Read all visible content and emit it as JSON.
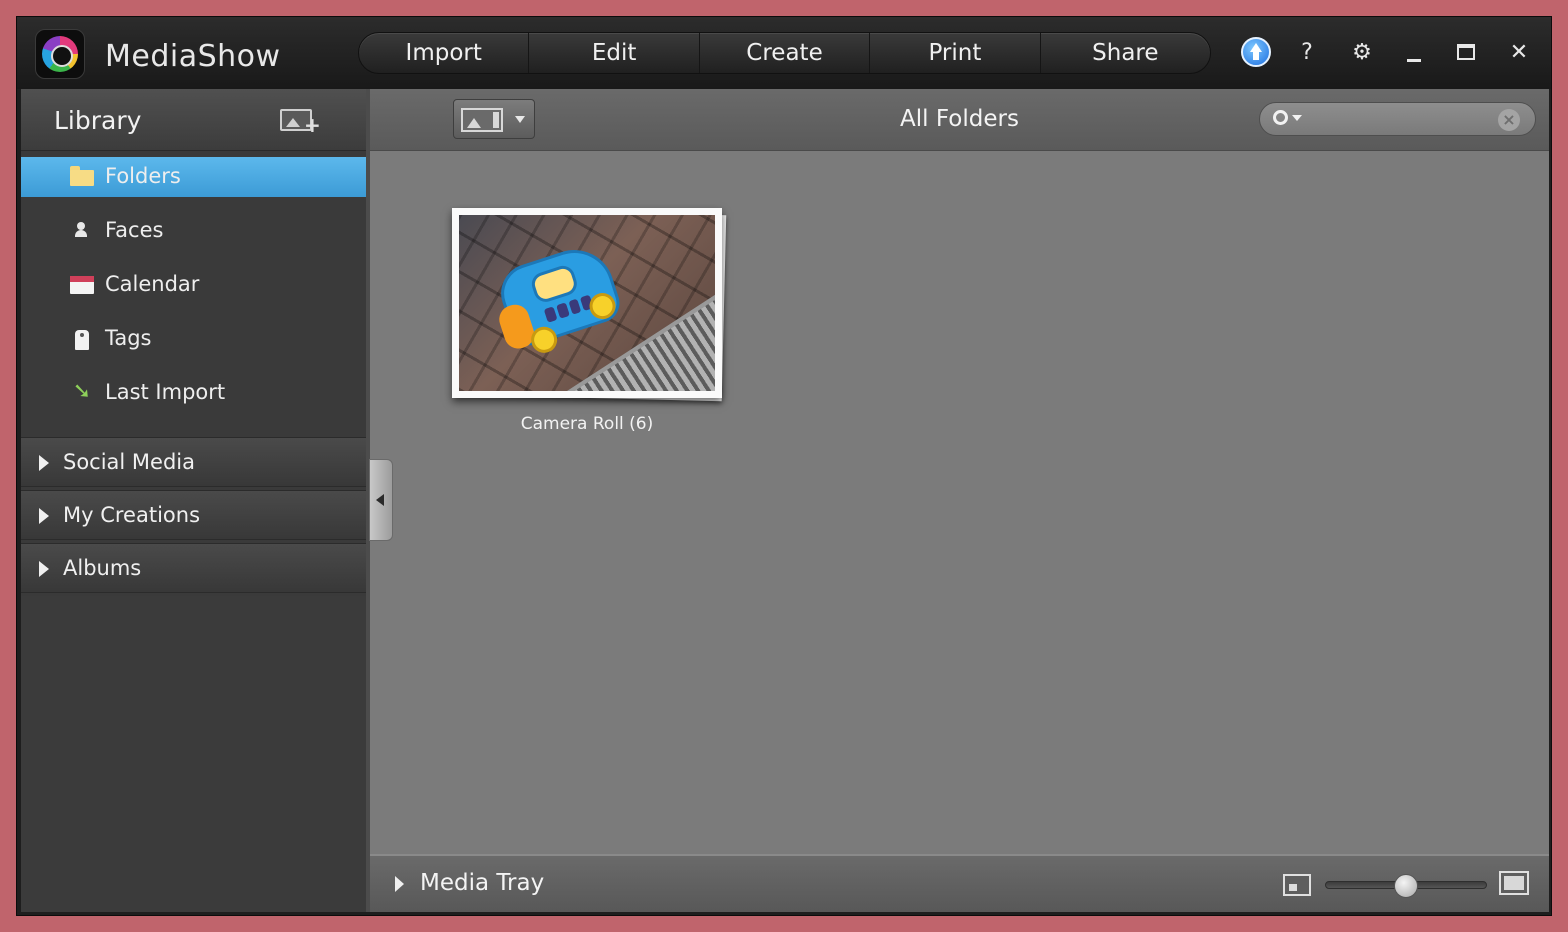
{
  "app": {
    "title": "MediaShow"
  },
  "menu": [
    {
      "label": "Import"
    },
    {
      "label": "Edit"
    },
    {
      "label": "Create"
    },
    {
      "label": "Print"
    },
    {
      "label": "Share"
    }
  ],
  "window_controls": {
    "help": "?",
    "settings": "⚙",
    "close": "✕"
  },
  "sidebar": {
    "title": "Library",
    "items": [
      {
        "label": "Folders",
        "icon": "folder-icon",
        "selected": true
      },
      {
        "label": "Faces",
        "icon": "faces-icon",
        "selected": false
      },
      {
        "label": "Calendar",
        "icon": "calendar-icon",
        "selected": false
      },
      {
        "label": "Tags",
        "icon": "tag-icon",
        "selected": false
      },
      {
        "label": "Last Import",
        "icon": "last-import-icon",
        "selected": false
      }
    ],
    "sections": [
      {
        "label": "Social Media"
      },
      {
        "label": "My Creations"
      },
      {
        "label": "Albums"
      }
    ]
  },
  "main": {
    "view_title": "All Folders",
    "search": {
      "value": "",
      "placeholder": ""
    },
    "folders": [
      {
        "label": "Camera Roll (6)"
      }
    ]
  },
  "tray": {
    "label": "Media Tray",
    "zoom_level": 0.5
  },
  "colors": {
    "selection": "#3c9bd6",
    "background": "#7b7b7b",
    "titlebar": "#1e1e1e"
  }
}
